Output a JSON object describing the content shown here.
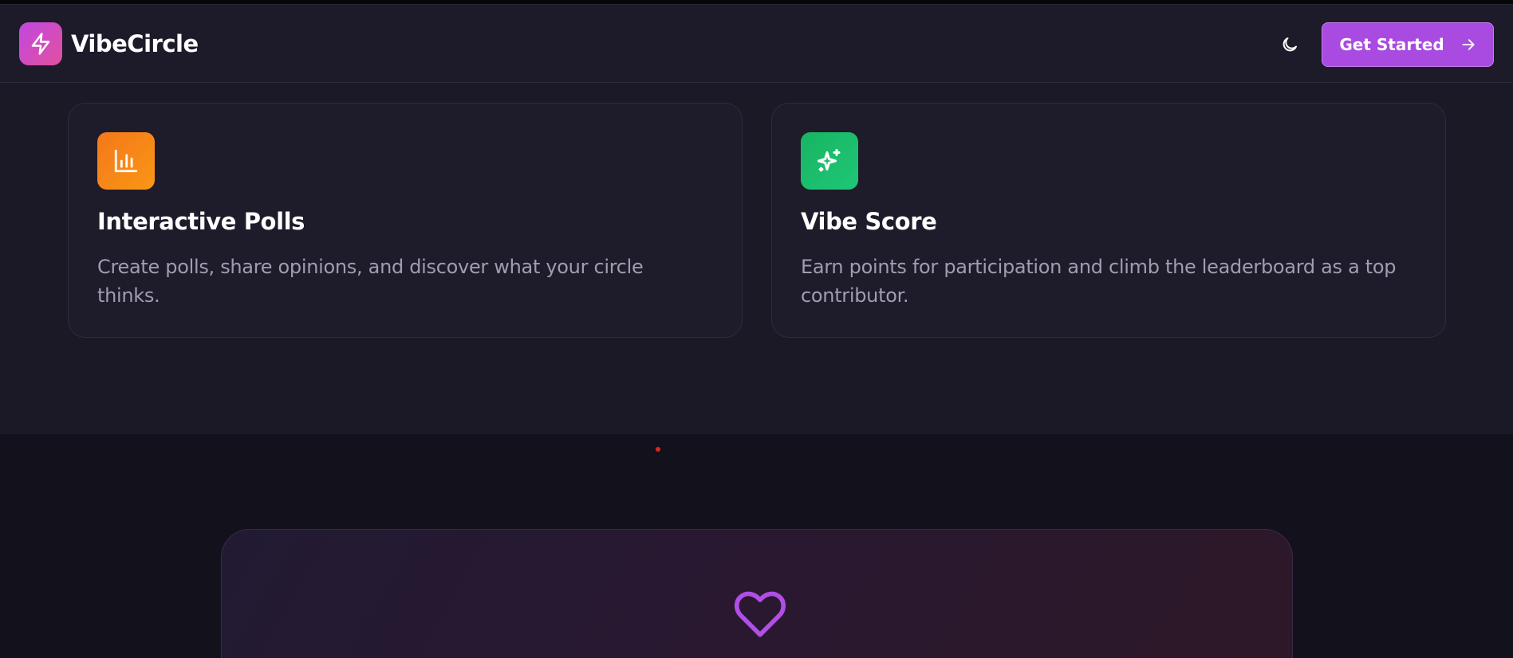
{
  "header": {
    "brand": "VibeCircle",
    "logo_icon": "lightning-bolt-icon",
    "theme_toggle_icon": "moon-icon",
    "cta_label": "Get Started",
    "cta_icon": "arrow-right-icon"
  },
  "features": [
    {
      "icon": "bar-chart-icon",
      "title": "Interactive Polls",
      "description": "Create polls, share opinions, and discover what your circle thinks."
    },
    {
      "icon": "sparkles-icon",
      "title": "Vibe Score",
      "description": "Earn points for participation and climb the leaderboard as a top contributor."
    }
  ],
  "cta_section": {
    "icon": "heart-icon"
  },
  "colors": {
    "accent": "#a94be0",
    "logo_gradient_start": "#c048e0",
    "logo_gradient_end": "#e2509f",
    "polls_icon_bg": "#f5771b",
    "score_icon_bg": "#18b462",
    "heart": "#b04ee6"
  }
}
